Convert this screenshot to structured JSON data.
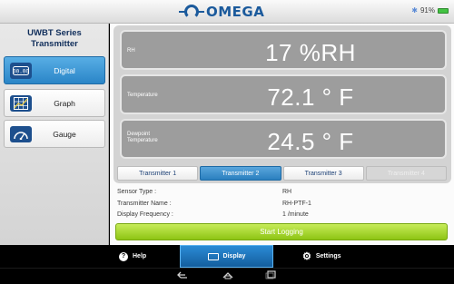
{
  "brand": {
    "logo_text": "OMEGA"
  },
  "status_bar": {
    "battery": "91%"
  },
  "sidebar": {
    "title_line1": "UWBT Series",
    "title_line2": "Transmitter",
    "items": [
      {
        "label": "Digital",
        "icon": "digital-display-icon",
        "active": true
      },
      {
        "label": "Graph",
        "icon": "graph-grid-icon",
        "active": false
      },
      {
        "label": "Gauge",
        "icon": "gauge-icon",
        "active": false
      }
    ]
  },
  "readings": [
    {
      "label": "RH",
      "value": "17 %RH"
    },
    {
      "label": "Temperature",
      "value": "72.1 ° F"
    },
    {
      "label_line1": "Dewpoint",
      "label_line2": "Temperature",
      "value": "24.5 ° F"
    }
  ],
  "tabs": [
    {
      "label": "Transmitter 1",
      "state": "normal"
    },
    {
      "label": "Transmitter 2",
      "state": "active"
    },
    {
      "label": "Transmitter 3",
      "state": "normal"
    },
    {
      "label": "Transmitter 4",
      "state": "disabled"
    }
  ],
  "info": {
    "sensor_type_label": "Sensor Type :",
    "sensor_type_value": "RH",
    "transmitter_name_label": "Transmitter Name :",
    "transmitter_name_value": "RH-PTF-1",
    "display_frequency_label": "Display Frequency :",
    "display_frequency_value": "1 /minute"
  },
  "start_button": {
    "label": "Start Logging"
  },
  "action_bar": {
    "help_label": "Help",
    "display_label": "Display",
    "settings_label": "Settings"
  },
  "colors": {
    "accent_blue": "#2a85c7",
    "start_green": "#8dc414",
    "reading_bg": "#9d9d9d"
  }
}
